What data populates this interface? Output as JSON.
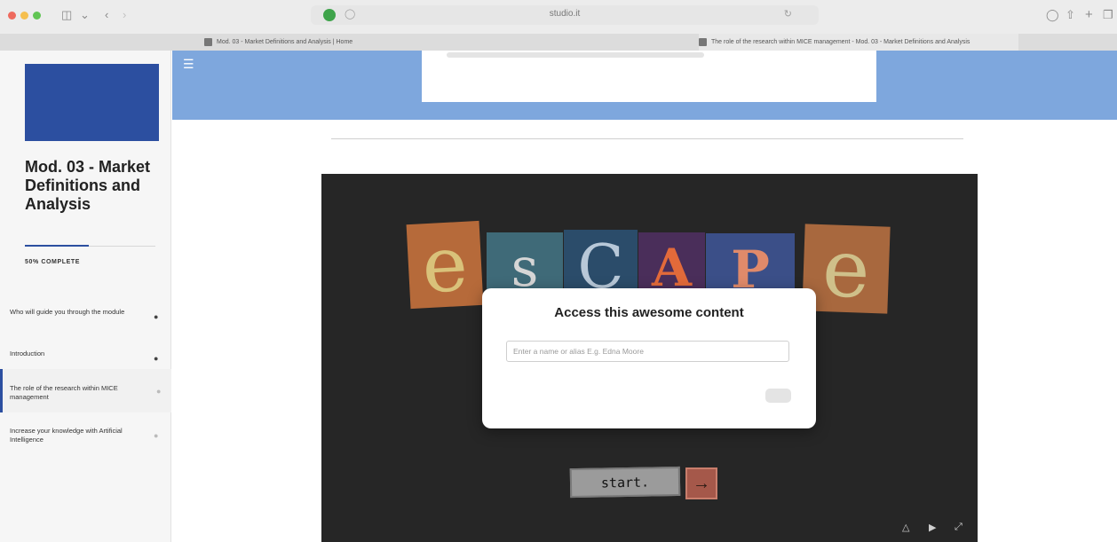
{
  "browser": {
    "url": "studio.it",
    "tabs": [
      {
        "title": "Mod. 03 - Market Definitions and Analysis | Home",
        "active": false
      },
      {
        "title": "The role of the research within MICE management - Mod. 03 - Market Definitions and Analysis",
        "active": true
      }
    ],
    "icons": [
      "sidebar-icon",
      "back-icon",
      "forward-icon",
      "shield-icon",
      "reload-icon",
      "download-icon",
      "share-icon",
      "new-tab-icon",
      "tab-overview-icon"
    ]
  },
  "sidebar": {
    "course_title": "Mod. 03 - Market Definitions and Analysis",
    "progress": "50% COMPLETE",
    "progress_fraction": 0.5,
    "lessons": [
      {
        "label": "Who will guide you through the module",
        "complete": true
      },
      {
        "label": "Introduction",
        "complete": true
      },
      {
        "label": "The role of the research within MICE management",
        "complete": false,
        "active": true
      },
      {
        "label": "Increase your knowledge with Artificial Intelligence",
        "complete": false
      }
    ]
  },
  "player": {
    "escape_letters": [
      "e",
      "s",
      "C",
      "A",
      "P",
      "e"
    ],
    "start_label": "start.",
    "arrow": "→"
  },
  "modal": {
    "title": "Access this awesome content",
    "input_placeholder": "Enter a name or alias E.g. Edna Moore"
  },
  "colors": {
    "accent": "#2c4fa0",
    "banner": "#7ea7dd",
    "player_bg": "#262626"
  }
}
